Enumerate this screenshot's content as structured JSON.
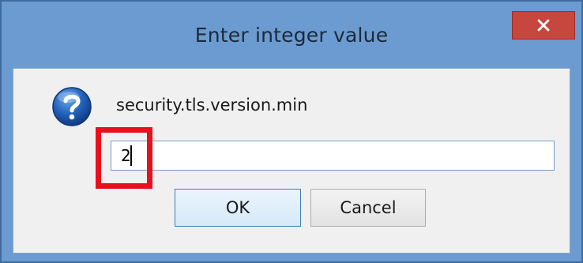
{
  "dialog": {
    "title": "Enter integer value",
    "close_symbol": "×",
    "prompt": "security.tls.version.min",
    "input_value": "2",
    "ok_label": "OK",
    "cancel_label": "Cancel",
    "icon": "question-icon"
  },
  "colors": {
    "titlebar": "#6b9bd0",
    "close_button": "#c7463e",
    "highlight": "#e8101c",
    "client_bg": "#f0f0f0"
  }
}
